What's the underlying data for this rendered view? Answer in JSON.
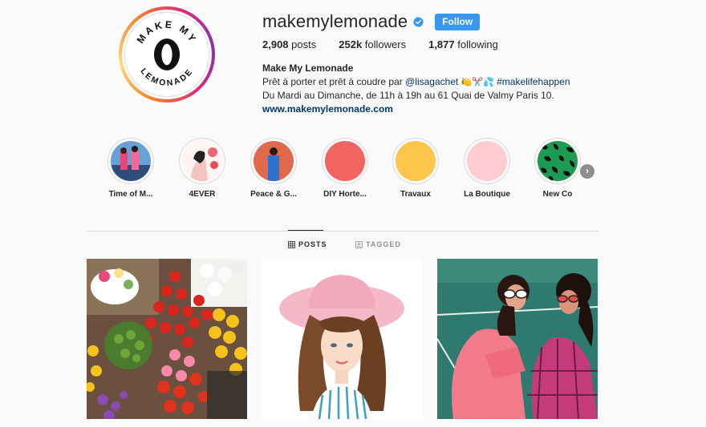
{
  "profile": {
    "avatar_text_top": "MAKE MY",
    "avatar_text_bottom": "LEMONADE",
    "username": "makemylemonade",
    "verified": true,
    "follow_label": "Follow",
    "stats": {
      "posts_count": "2,908",
      "posts_label": "posts",
      "followers_count": "252k",
      "followers_label": "followers",
      "following_count": "1,877",
      "following_label": "following"
    },
    "bio": {
      "name": "Make My Lemonade",
      "line1_prefix": "Prêt à porter et prêt à coudre par ",
      "mention": "@lisagachet",
      "emojis": "🍋✂️💦",
      "hashtag": "#makelifehappen",
      "line2": "Du Mardi au Dimanche, de 11h à 19h au 61 Quai de Valmy Paris 10.",
      "website": "www.makemylemonade.com"
    }
  },
  "highlights": [
    {
      "label": "Time of M...",
      "color": "#3b6fb0"
    },
    {
      "label": "4EVER",
      "color": "#f4d6d6"
    },
    {
      "label": "Peace & G...",
      "color": "#e06a4c"
    },
    {
      "label": "DIY Horte...",
      "color": "#f06461"
    },
    {
      "label": "Travaux",
      "color": "#fdc54c"
    },
    {
      "label": "La Boutique",
      "color": "#ffccd2"
    },
    {
      "label": "New Co",
      "color": "#1e9b52"
    }
  ],
  "highlights_next_icon": "chevron-right-icon",
  "tabs": [
    {
      "label": "POSTS",
      "icon": "grid-icon",
      "active": true
    },
    {
      "label": "TAGGED",
      "icon": "tag-icon",
      "active": false
    }
  ],
  "accent_color": "#3897f0"
}
